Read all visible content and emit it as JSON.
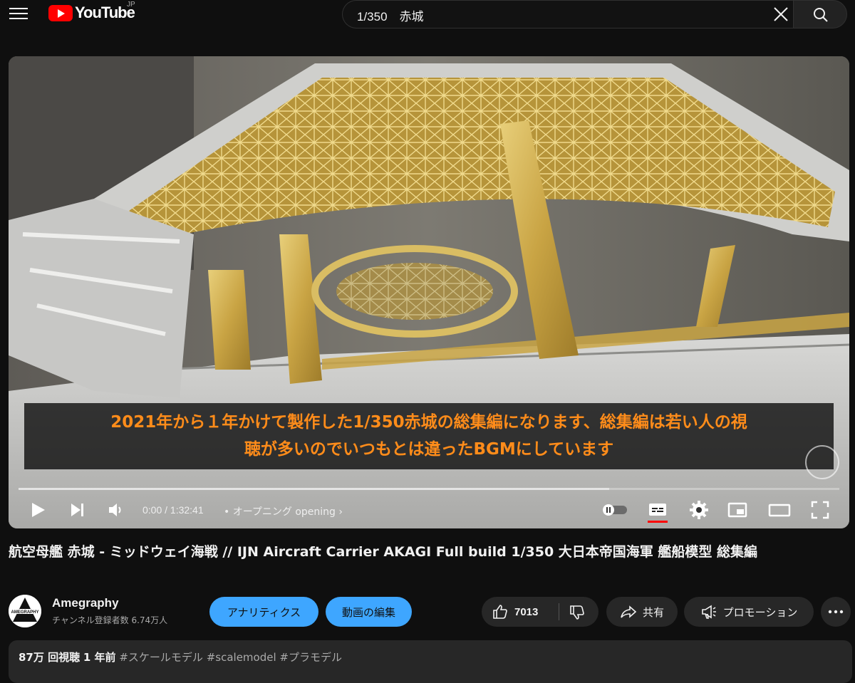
{
  "header": {
    "logo_text": "YouTube",
    "country_code": "JP",
    "search_value": "1/350　赤城"
  },
  "player": {
    "subtitle_line1": "2021年から１年かけて製作した1/350赤城の総集編になります、総集編は若い人の視",
    "subtitle_line2": "聴が多いのでいつもとは違ったBGMにしています",
    "time_current": "0:00",
    "time_separator": " / ",
    "time_total": "1:32:41",
    "chapter_prefix": "•",
    "chapter": "オープニング opening",
    "progress_fraction": 0.0,
    "buffered_fraction": 0.72,
    "colors": {
      "subtitle": "#ff8c1a",
      "caption_underline": "#ff0000"
    }
  },
  "video": {
    "title": "航空母艦 赤城 - ミッドウェイ海戦 // IJN Aircraft Carrier AKAGI Full build 1/350 大日本帝国海軍 艦船模型 総集編"
  },
  "channel": {
    "name": "Amegraphy",
    "subscribers": "チャンネル登録者数 6.74万人",
    "avatar_text": "AMEGRAPHY"
  },
  "actions": {
    "analytics": "アナリティクス",
    "edit_video": "動画の編集",
    "like_count": "7013",
    "share": "共有",
    "promotion": "プロモーション"
  },
  "description": {
    "views": "87万 回視聴",
    "age": "1 年前",
    "tags": [
      "#スケールモデル",
      "#scalemodel",
      "#プラモデル"
    ]
  },
  "icons": {
    "menu": "hamburger-icon",
    "search": "search-icon",
    "clear": "close-icon",
    "play": "play-icon",
    "next": "skip-next-icon",
    "volume": "volume-icon",
    "autoplay": "autoplay-toggle",
    "captions": "subtitles-icon",
    "settings": "gear-icon",
    "miniplayer": "miniplayer-icon",
    "theater": "theater-icon",
    "fullscreen": "fullscreen-icon",
    "like": "thumbs-up-icon",
    "dislike": "thumbs-down-icon",
    "share": "share-icon",
    "promotion": "megaphone-icon",
    "more": "more-horiz-icon"
  }
}
